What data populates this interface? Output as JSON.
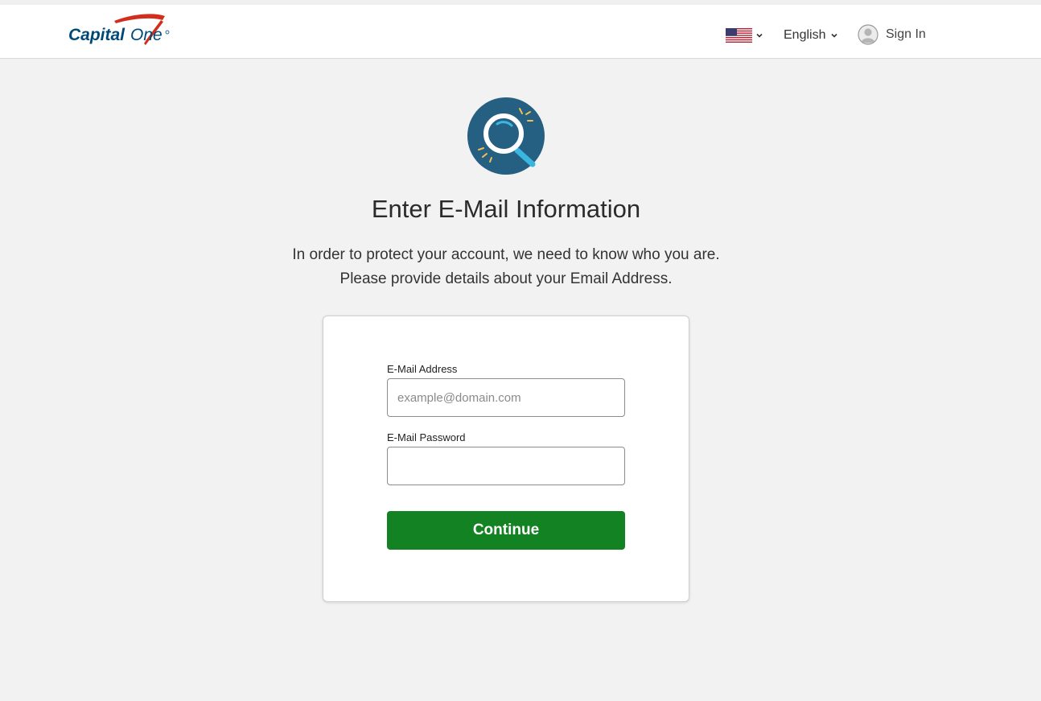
{
  "header": {
    "logo_text": "Capital One",
    "language_label": "English",
    "signin_label": "Sign In"
  },
  "hero": {
    "title": "Enter E-Mail Information",
    "subtitle_line1": "In order to protect your account, we need to know who you are.",
    "subtitle_line2": "Please provide details about your Email Address."
  },
  "form": {
    "email_label": "E-Mail Address",
    "email_placeholder": "example@domain.com",
    "email_value": "",
    "password_label": "E-Mail Password",
    "password_value": "",
    "continue_label": "Continue"
  },
  "colors": {
    "brand_red": "#d22e1e",
    "brand_navy": "#004977",
    "button_green": "#138223",
    "icon_circle": "#255f82",
    "icon_accent": "#3bb6e0",
    "icon_spark": "#f2c14e"
  },
  "icons": {
    "flag": "us-flag-icon",
    "chevron": "chevron-down-icon",
    "user": "user-avatar-icon",
    "hero": "magnifier-icon"
  }
}
